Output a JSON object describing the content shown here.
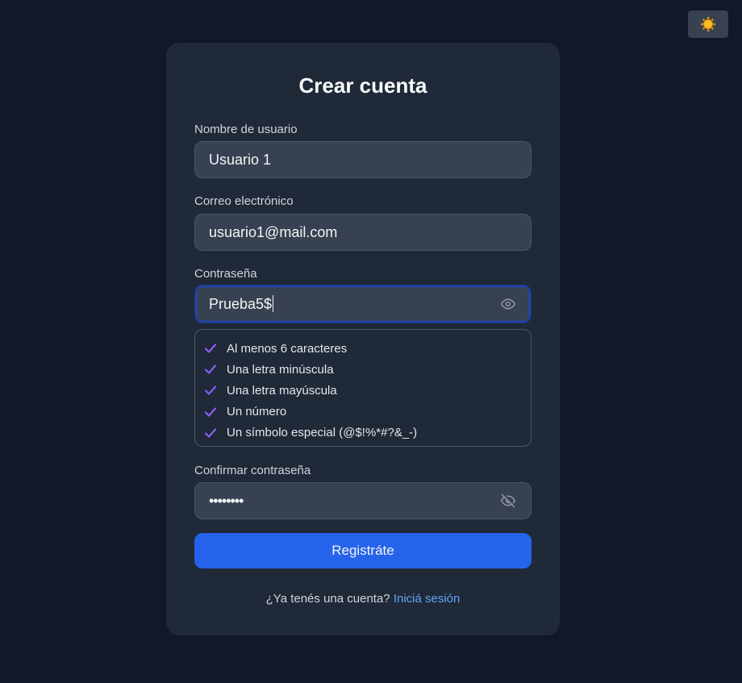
{
  "theme_toggle": {
    "icon": "sun-icon"
  },
  "form": {
    "title": "Crear cuenta",
    "username": {
      "label": "Nombre de usuario",
      "value": "Usuario 1"
    },
    "email": {
      "label": "Correo electrónico",
      "value": "usuario1@mail.com"
    },
    "password": {
      "label": "Contraseña",
      "value": "Prueba5$",
      "toggle_icon": "eye-icon"
    },
    "password_rules": [
      {
        "text": "Al menos 6 caracteres",
        "met": true
      },
      {
        "text": "Una letra minúscula",
        "met": true
      },
      {
        "text": "Una letra mayúscula",
        "met": true
      },
      {
        "text": "Un número",
        "met": true
      },
      {
        "text": "Un símbolo especial (@$!%*#?&_-)",
        "met": true
      }
    ],
    "confirm_password": {
      "label": "Confirmar contraseña",
      "value": "••••••••",
      "toggle_icon": "eye-off-icon"
    },
    "submit_label": "Registráte",
    "footer_text": "¿Ya tenés una cuenta?",
    "footer_link": "Iniciá sesión"
  },
  "colors": {
    "background": "#111827",
    "card": "#1f2937",
    "input": "#374151",
    "primary": "#2563eb",
    "link": "#60a5fa",
    "check": "#8b5cf6"
  }
}
